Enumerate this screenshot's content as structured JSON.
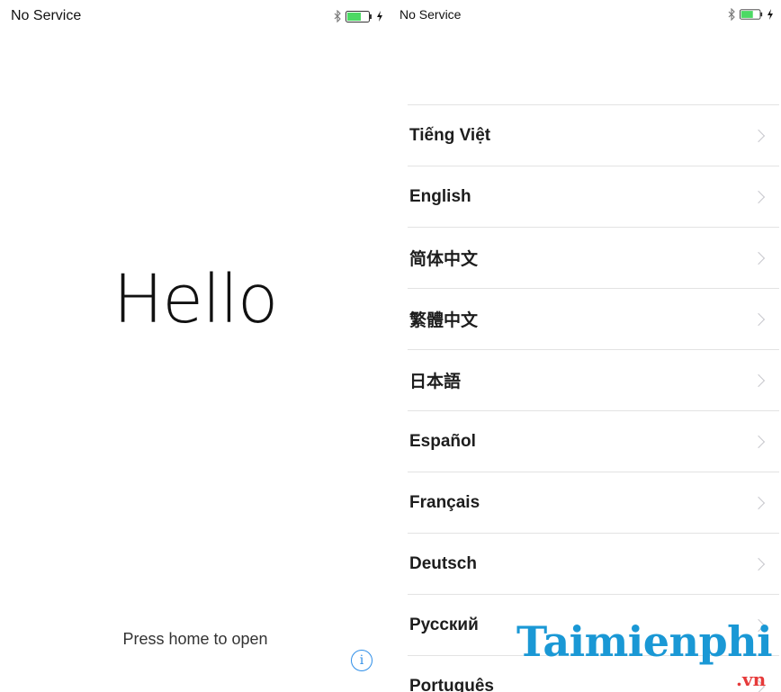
{
  "left_screen": {
    "status_bar": {
      "carrier": "No Service",
      "icons": [
        "bluetooth-icon",
        "battery-icon",
        "charging-icon"
      ]
    },
    "greeting": "Hello",
    "hint": "Press home to open",
    "info_button": {
      "icon": "info-icon",
      "glyph": "i"
    }
  },
  "right_screen": {
    "status_bar": {
      "carrier": "No Service",
      "icons": [
        "bluetooth-icon",
        "battery-icon",
        "charging-icon"
      ]
    },
    "languages": [
      "Tiếng Việt",
      "English",
      "简体中文",
      "繁體中文",
      "日本語",
      "Español",
      "Français",
      "Deutsch",
      "Русский",
      "Português"
    ]
  },
  "watermark": {
    "brand": "Taimienphi",
    "suffix": ".vn"
  },
  "colors": {
    "accent_blue": "#2e8ee8",
    "battery_green": "#4cd964",
    "separator": "#e3e3e3",
    "chevron": "#c7c7cc",
    "watermark_blue": "#1a98d5",
    "watermark_red": "#e63a3a"
  }
}
